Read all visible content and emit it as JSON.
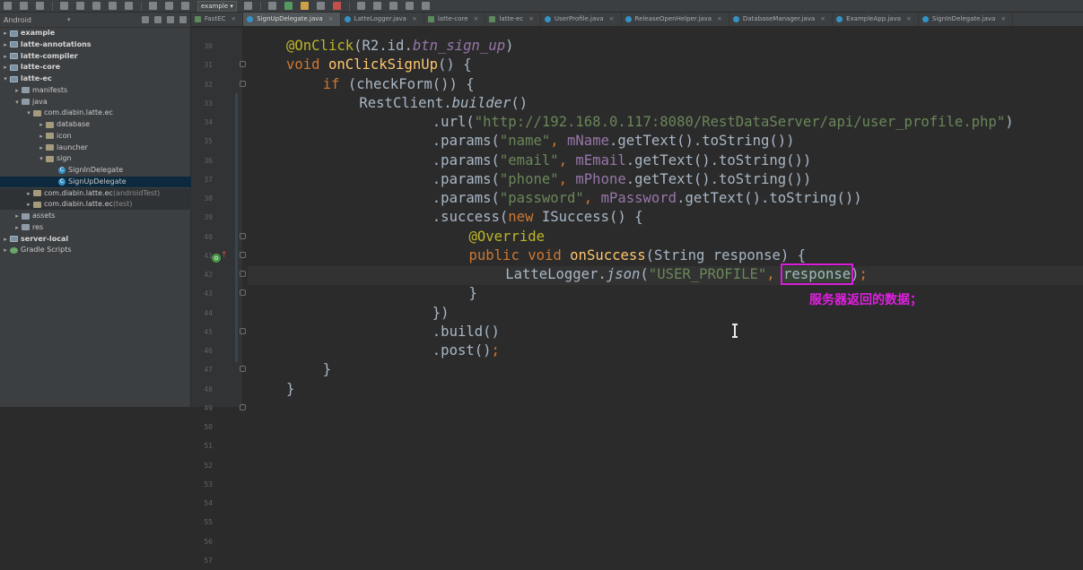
{
  "toolbar": {
    "run_config": "example",
    "icons": [
      "open-icon",
      "save-icon",
      "sync-icon",
      "undo-icon",
      "redo-icon",
      "cut-icon",
      "copy-icon",
      "paste-icon",
      "find-icon",
      "replace-icon",
      "back-icon",
      "forward-icon",
      "build-icon",
      "run-icon",
      "debug-icon",
      "attach-icon",
      "stop-icon",
      "avd-icon",
      "sdk-icon",
      "structure-icon",
      "help-icon",
      "device-icon"
    ]
  },
  "project": {
    "view_label": "Android",
    "tree": [
      {
        "label": "example",
        "kind": "module",
        "arrow": "▸",
        "bold": true
      },
      {
        "label": "latte-annotations",
        "kind": "module",
        "arrow": "▸",
        "bold": true
      },
      {
        "label": "latte-compiler",
        "kind": "module",
        "arrow": "▸",
        "bold": true
      },
      {
        "label": "latte-core",
        "kind": "module",
        "arrow": "▸",
        "bold": true
      },
      {
        "label": "latte-ec",
        "kind": "module",
        "arrow": "▾",
        "bold": true
      },
      {
        "label": "manifests",
        "kind": "folder",
        "arrow": "▸"
      },
      {
        "label": "java",
        "kind": "folder",
        "arrow": "▾"
      },
      {
        "label": "com.diabin.latte.ec",
        "kind": "pkg",
        "arrow": "▾"
      },
      {
        "label": "database",
        "kind": "pkg",
        "arrow": "▸"
      },
      {
        "label": "icon",
        "kind": "pkg",
        "arrow": "▸"
      },
      {
        "label": "launcher",
        "kind": "pkg",
        "arrow": "▸"
      },
      {
        "label": "sign",
        "kind": "pkg",
        "arrow": "▾"
      },
      {
        "label": "SignInDelegate",
        "kind": "class",
        "arrow": ""
      },
      {
        "label": "SignUpDelegate",
        "kind": "class",
        "arrow": "",
        "selected": true
      },
      {
        "label": "com.diabin.latte.ec",
        "suffix": "(androidTest)",
        "kind": "pkg",
        "arrow": "▸",
        "faint": true
      },
      {
        "label": "com.diabin.latte.ec",
        "suffix": "(test)",
        "kind": "pkg",
        "arrow": "▸",
        "faint": true
      },
      {
        "label": "assets",
        "kind": "folder",
        "arrow": "▸"
      },
      {
        "label": "res",
        "kind": "folder",
        "arrow": "▸"
      },
      {
        "label": "server-local",
        "kind": "module",
        "arrow": "▸",
        "bold": true
      },
      {
        "label": "Gradle Scripts",
        "kind": "gradle",
        "arrow": "▸"
      }
    ]
  },
  "tabs": [
    {
      "label": "FastEC",
      "kind": "module"
    },
    {
      "label": "SignUpDelegate.java",
      "kind": "class",
      "active": true
    },
    {
      "label": "LatteLogger.java",
      "kind": "class"
    },
    {
      "label": "latte-core",
      "kind": "module"
    },
    {
      "label": "latte-ec",
      "kind": "module"
    },
    {
      "label": "UserProfile.java",
      "kind": "class"
    },
    {
      "label": "ReleaseOpenHelper.java",
      "kind": "class"
    },
    {
      "label": "DatabaseManager.java",
      "kind": "class"
    },
    {
      "label": "ExampleApp.java",
      "kind": "class"
    },
    {
      "label": "SignInDelegate.java",
      "kind": "class"
    }
  ],
  "editor": {
    "line_numbers": [
      "30",
      "31",
      "32",
      "33",
      "34",
      "35",
      "36",
      "37",
      "38",
      "39",
      "40",
      "41",
      "42",
      "43",
      "44",
      "45",
      "46",
      "47",
      "48",
      "49",
      "50",
      "51",
      "52",
      "53",
      "54",
      "55",
      "56",
      "57"
    ],
    "lines": [
      {
        "indent": 0,
        "parts": [
          [
            "an",
            "@OnClick"
          ],
          [
            "",
            "(R2.id."
          ],
          [
            "fld it",
            "btn_sign_up"
          ],
          [
            "",
            ")"
          ]
        ]
      },
      {
        "indent": 0,
        "parts": [
          [
            "k",
            "void "
          ],
          [
            "fn",
            "onClickSignUp"
          ],
          [
            "",
            "() {"
          ]
        ]
      },
      {
        "indent": 1,
        "parts": [
          [
            "k",
            "if "
          ],
          [
            "",
            "(checkForm()) {"
          ]
        ]
      },
      {
        "indent": 2,
        "parts": [
          [
            "",
            "RestClient."
          ],
          [
            "it",
            "builder"
          ],
          [
            "",
            "()"
          ]
        ]
      },
      {
        "indent": 4,
        "parts": [
          [
            "",
            ".url("
          ],
          [
            "st",
            "\"http://192.168.0.117:8080/RestDataServer/api/user_profile.php\""
          ],
          [
            "",
            ")"
          ]
        ]
      },
      {
        "indent": 4,
        "parts": [
          [
            "",
            ".params("
          ],
          [
            "st",
            "\"name\""
          ],
          [
            "k",
            ", "
          ],
          [
            "fld",
            "mName"
          ],
          [
            "",
            ".getText().toString())"
          ]
        ]
      },
      {
        "indent": 4,
        "parts": [
          [
            "",
            ".params("
          ],
          [
            "st",
            "\"email\""
          ],
          [
            "k",
            ", "
          ],
          [
            "fld",
            "mEmail"
          ],
          [
            "",
            ".getText().toString())"
          ]
        ]
      },
      {
        "indent": 4,
        "parts": [
          [
            "",
            ".params("
          ],
          [
            "st",
            "\"phone\""
          ],
          [
            "k",
            ", "
          ],
          [
            "fld",
            "mPhone"
          ],
          [
            "",
            ".getText().toString())"
          ]
        ]
      },
      {
        "indent": 4,
        "parts": [
          [
            "",
            ".params("
          ],
          [
            "st",
            "\"password\""
          ],
          [
            "k",
            ", "
          ],
          [
            "fld",
            "mPassword"
          ],
          [
            "",
            ".getText().toString())"
          ]
        ]
      },
      {
        "indent": 4,
        "parts": [
          [
            "",
            ".success("
          ],
          [
            "k",
            "new "
          ],
          [
            "",
            "ISuccess() {"
          ]
        ]
      },
      {
        "indent": 5,
        "parts": [
          [
            "an",
            "@Override"
          ]
        ]
      },
      {
        "indent": 5,
        "parts": [
          [
            "k",
            "public void "
          ],
          [
            "fn",
            "onSuccess"
          ],
          [
            "",
            "(String response) {"
          ]
        ]
      },
      {
        "indent": 6,
        "parts": [
          [
            "",
            "LatteLogger."
          ],
          [
            "it",
            "json"
          ],
          [
            "",
            "("
          ],
          [
            "st",
            "\"USER_PROFILE\""
          ],
          [
            "k",
            ", "
          ],
          [
            "hl",
            "response"
          ],
          [
            "",
            ")"
          ],
          [
            "k",
            ";"
          ]
        ]
      },
      {
        "indent": 5,
        "parts": [
          [
            "",
            "}"
          ]
        ]
      },
      {
        "indent": 4,
        "parts": [
          [
            "",
            "})"
          ]
        ]
      },
      {
        "indent": 4,
        "parts": [
          [
            "",
            ".build()"
          ]
        ]
      },
      {
        "indent": 4,
        "parts": [
          [
            "",
            ".post()"
          ],
          [
            "k",
            ";"
          ]
        ]
      },
      {
        "indent": 1,
        "parts": [
          [
            "",
            "}"
          ]
        ]
      },
      {
        "indent": 0,
        "parts": [
          [
            "",
            "}"
          ]
        ]
      }
    ],
    "annotation_note": "服务器返回的数据；"
  }
}
